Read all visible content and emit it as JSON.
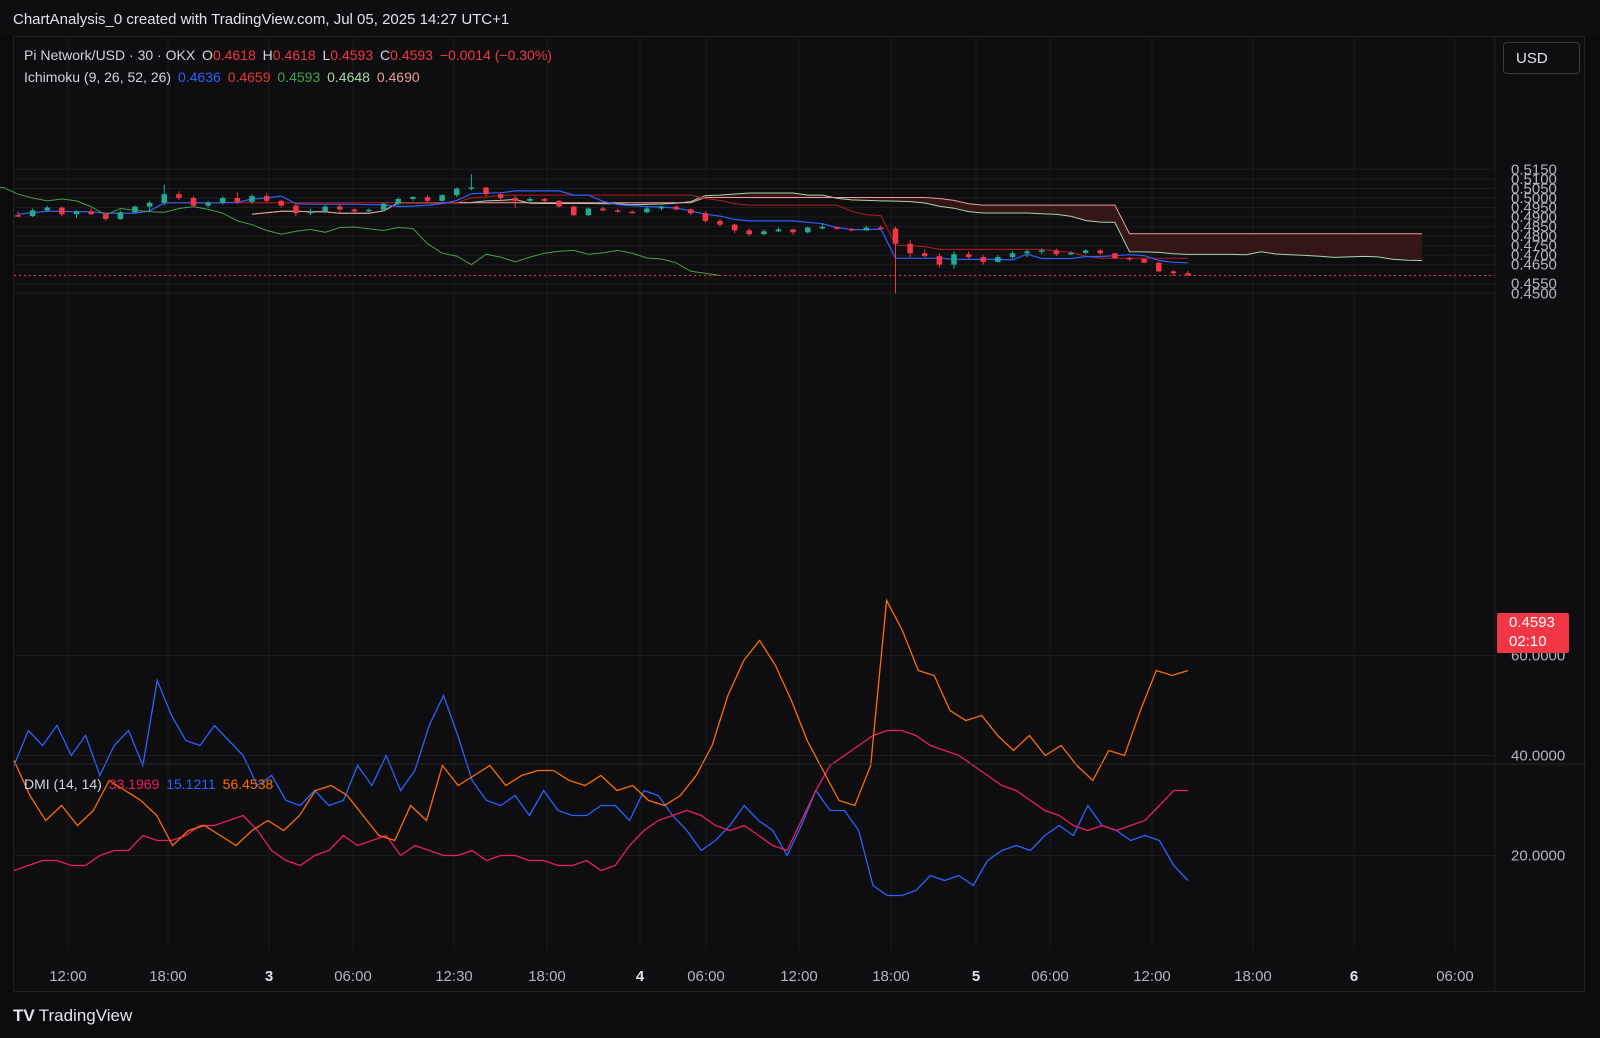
{
  "header": {
    "title": "ChartAnalysis_0 created with TradingView.com, Jul 05, 2025 14:27 UTC+1"
  },
  "currency_button": "USD",
  "branding": {
    "logo_glyph": "TV",
    "name": "TradingView"
  },
  "legend_main": {
    "symbol": "Pi Network/USD · 30 · OKX",
    "o_label": "O",
    "o_value": "0.4618",
    "h_label": "H",
    "h_value": "0.4618",
    "l_label": "L",
    "l_value": "0.4593",
    "c_label": "C",
    "c_value": "0.4593",
    "change": "−0.0014 (−0.30%)"
  },
  "legend_ichimoku": {
    "label": "Ichimoku (9, 26, 52, 26)",
    "values": [
      "0.4636",
      "0.4659",
      "0.4593",
      "0.4648",
      "0.4690"
    ]
  },
  "legend_dmi": {
    "label": "DMI (14, 14)",
    "values": [
      "33.1969",
      "15.1211",
      "56.4538"
    ]
  },
  "last_price": {
    "value": "0.4593",
    "countdown": "02:10"
  },
  "colors": {
    "up": "#22ab94",
    "down": "#f23645",
    "tenkan": "#2962ff",
    "kijun": "#b71c1c",
    "chikou": "#43a047",
    "span_a": "#a5d6a7",
    "span_b": "#ef9a9a",
    "cloud_bear": "#3b1718",
    "cloud_bull": "#123219",
    "plus_di": "#2962ff",
    "minus_di": "#e91e63",
    "adx": "#ff6d00"
  },
  "chart_data": [
    {
      "type": "candlestick",
      "title": "Pi Network/USD · 30 · OKX",
      "ylim": [
        0.446,
        0.5175
      ],
      "y_ticks": [
        "0.5150",
        "0.5100",
        "0.5050",
        "0.5000",
        "0.4950",
        "0.4900",
        "0.4850",
        "0.4800",
        "0.4750",
        "0.4700",
        "0.4650",
        "0.4550",
        "0.4500"
      ],
      "x_ticks": [
        "12:00",
        "18:00",
        "3",
        "06:00",
        "12:30",
        "18:00",
        "4",
        "06:00",
        "12:00",
        "18:00",
        "5",
        "06:00",
        "12:00",
        "18:00",
        "6",
        "06:00"
      ],
      "candles_ohlc_approx": [
        [
          0.491,
          0.493,
          0.49,
          0.4905
        ],
        [
          0.4905,
          0.4945,
          0.49,
          0.4935
        ],
        [
          0.4935,
          0.496,
          0.493,
          0.495
        ],
        [
          0.495,
          0.4955,
          0.4905,
          0.4915
        ],
        [
          0.4915,
          0.4935,
          0.4895,
          0.493
        ],
        [
          0.493,
          0.4945,
          0.491,
          0.4915
        ],
        [
          0.4915,
          0.4925,
          0.488,
          0.489
        ],
        [
          0.489,
          0.4935,
          0.4885,
          0.4925
        ],
        [
          0.4925,
          0.496,
          0.492,
          0.4955
        ],
        [
          0.4955,
          0.4985,
          0.493,
          0.4975
        ],
        [
          0.4975,
          0.507,
          0.496,
          0.502
        ],
        [
          0.502,
          0.5035,
          0.499,
          0.5
        ],
        [
          0.5,
          0.501,
          0.495,
          0.496
        ],
        [
          0.496,
          0.4985,
          0.495,
          0.4975
        ],
        [
          0.4975,
          0.501,
          0.4965,
          0.5
        ],
        [
          0.5,
          0.503,
          0.497,
          0.498
        ],
        [
          0.498,
          0.502,
          0.497,
          0.501
        ],
        [
          0.501,
          0.5025,
          0.4975,
          0.4985
        ],
        [
          0.4985,
          0.499,
          0.495,
          0.496
        ],
        [
          0.496,
          0.497,
          0.4905,
          0.492
        ],
        [
          0.492,
          0.4945,
          0.491,
          0.493
        ],
        [
          0.493,
          0.4965,
          0.492,
          0.4955
        ],
        [
          0.4955,
          0.497,
          0.4925,
          0.494
        ],
        [
          0.494,
          0.4945,
          0.492,
          0.493
        ],
        [
          0.493,
          0.4945,
          0.4925,
          0.4938
        ],
        [
          0.4938,
          0.4975,
          0.493,
          0.497
        ],
        [
          0.497,
          0.5005,
          0.496,
          0.4995
        ],
        [
          0.4995,
          0.501,
          0.4985,
          0.5005
        ],
        [
          0.5005,
          0.5015,
          0.4975,
          0.4985
        ],
        [
          0.4985,
          0.502,
          0.498,
          0.5015
        ],
        [
          0.5015,
          0.5055,
          0.5005,
          0.505
        ],
        [
          0.505,
          0.5125,
          0.504,
          0.5055
        ],
        [
          0.5055,
          0.506,
          0.501,
          0.502
        ],
        [
          0.502,
          0.5025,
          0.499,
          0.5
        ],
        [
          0.5,
          0.5015,
          0.495,
          0.4985
        ],
        [
          0.4985,
          0.5005,
          0.4975,
          0.4995
        ],
        [
          0.4995,
          0.5,
          0.4975,
          0.4985
        ],
        [
          0.4985,
          0.499,
          0.495,
          0.4955
        ],
        [
          0.4955,
          0.496,
          0.4905,
          0.491
        ],
        [
          0.491,
          0.495,
          0.4905,
          0.4945
        ],
        [
          0.4945,
          0.4955,
          0.493,
          0.4935
        ],
        [
          0.4935,
          0.4945,
          0.4925,
          0.4928
        ],
        [
          0.4928,
          0.4935,
          0.492,
          0.4925
        ],
        [
          0.4925,
          0.4955,
          0.492,
          0.4945
        ],
        [
          0.4945,
          0.496,
          0.4935,
          0.4955
        ],
        [
          0.4955,
          0.496,
          0.4935,
          0.494
        ],
        [
          0.494,
          0.4945,
          0.491,
          0.492
        ],
        [
          0.492,
          0.493,
          0.487,
          0.488
        ],
        [
          0.488,
          0.489,
          0.485,
          0.486
        ],
        [
          0.486,
          0.4865,
          0.4815,
          0.483
        ],
        [
          0.483,
          0.484,
          0.48,
          0.481
        ],
        [
          0.481,
          0.4835,
          0.4805,
          0.4825
        ],
        [
          0.4825,
          0.4845,
          0.482,
          0.4835
        ],
        [
          0.4835,
          0.484,
          0.4805,
          0.482
        ],
        [
          0.482,
          0.485,
          0.4815,
          0.4845
        ],
        [
          0.4845,
          0.4868,
          0.4835,
          0.4848
        ],
        [
          0.4848,
          0.485,
          0.4832,
          0.4838
        ],
        [
          0.4838,
          0.4842,
          0.4825,
          0.483
        ],
        [
          0.483,
          0.4855,
          0.4828,
          0.4845
        ],
        [
          0.4845,
          0.4855,
          0.4835,
          0.484
        ],
        [
          0.484,
          0.485,
          0.45,
          0.476
        ],
        [
          0.476,
          0.478,
          0.469,
          0.471
        ],
        [
          0.471,
          0.473,
          0.469,
          0.4695
        ],
        [
          0.4695,
          0.471,
          0.4635,
          0.465
        ],
        [
          0.465,
          0.472,
          0.463,
          0.4705
        ],
        [
          0.4705,
          0.472,
          0.468,
          0.469
        ],
        [
          0.469,
          0.47,
          0.465,
          0.4665
        ],
        [
          0.4665,
          0.47,
          0.466,
          0.469
        ],
        [
          0.469,
          0.472,
          0.468,
          0.471
        ],
        [
          0.471,
          0.473,
          0.469,
          0.472
        ],
        [
          0.472,
          0.4735,
          0.4705,
          0.4725
        ],
        [
          0.4725,
          0.4735,
          0.4695,
          0.4705
        ],
        [
          0.4705,
          0.472,
          0.47,
          0.4712
        ],
        [
          0.4712,
          0.473,
          0.4705,
          0.4725
        ],
        [
          0.4725,
          0.473,
          0.47,
          0.471
        ],
        [
          0.471,
          0.4712,
          0.468,
          0.4685
        ],
        [
          0.4685,
          0.469,
          0.467,
          0.468
        ],
        [
          0.468,
          0.4685,
          0.466,
          0.466
        ],
        [
          0.466,
          0.4665,
          0.461,
          0.4615
        ],
        [
          0.4615,
          0.462,
          0.459,
          0.4605
        ],
        [
          0.4605,
          0.4618,
          0.4593,
          0.4593
        ]
      ]
    },
    {
      "type": "line",
      "title": "DMI (14, 14)",
      "ylim": [
        10,
        72
      ],
      "y_ticks": [
        "60.0000",
        "40.0000",
        "20.0000"
      ],
      "series": [
        {
          "name": "+DI",
          "values": [
            38,
            45,
            42,
            46,
            40,
            44,
            36,
            42,
            45,
            38,
            55,
            48,
            43,
            42,
            46,
            43,
            40,
            34,
            36,
            31,
            30,
            33,
            30,
            31,
            38,
            34,
            40,
            33,
            37,
            46,
            52,
            44,
            35,
            31,
            30,
            32,
            28,
            33,
            29,
            28,
            28,
            30,
            30,
            27,
            33,
            32,
            28,
            25,
            21,
            23,
            26,
            30,
            27,
            25,
            20,
            26,
            33,
            29,
            29,
            25,
            14,
            12,
            12,
            13,
            16,
            15,
            16,
            14,
            19,
            21,
            22,
            21,
            24,
            26,
            24,
            30,
            26,
            25,
            23,
            24,
            23,
            18,
            15
          ]
        },
        {
          "name": "−DI",
          "values": [
            17,
            18,
            19,
            19,
            18,
            18,
            20,
            21,
            21,
            24,
            23,
            23,
            24,
            26,
            26,
            27,
            28,
            25,
            21,
            19,
            18,
            20,
            21,
            24,
            22,
            23,
            24,
            20,
            22,
            21,
            20,
            20,
            21,
            19,
            20,
            20,
            19,
            19,
            18,
            18,
            19,
            17,
            18,
            22,
            25,
            27,
            28,
            29,
            28,
            26,
            25,
            26,
            24,
            22,
            21,
            27,
            33,
            38,
            40,
            42,
            44,
            45,
            45,
            44,
            42,
            41,
            40,
            38,
            36,
            34,
            33,
            31,
            29,
            28,
            26,
            25,
            26,
            25,
            26,
            27,
            30,
            33,
            33
          ]
        },
        {
          "name": "ADX",
          "values": [
            39,
            32,
            27,
            30,
            26,
            29,
            35,
            33,
            31,
            28,
            22,
            25,
            26,
            24,
            22,
            25,
            27,
            25,
            28,
            33,
            34,
            32,
            28,
            24,
            23,
            30,
            27,
            38,
            34,
            36,
            38,
            34,
            36,
            37,
            37,
            35,
            34,
            36,
            33,
            34,
            31,
            30,
            32,
            36,
            42,
            52,
            59,
            63,
            58,
            51,
            43,
            37,
            31,
            30,
            38,
            71,
            65,
            57,
            56,
            49,
            47,
            48,
            44,
            41,
            44,
            40,
            42,
            38,
            35,
            41,
            40,
            49,
            57,
            56,
            57
          ]
        }
      ]
    }
  ]
}
